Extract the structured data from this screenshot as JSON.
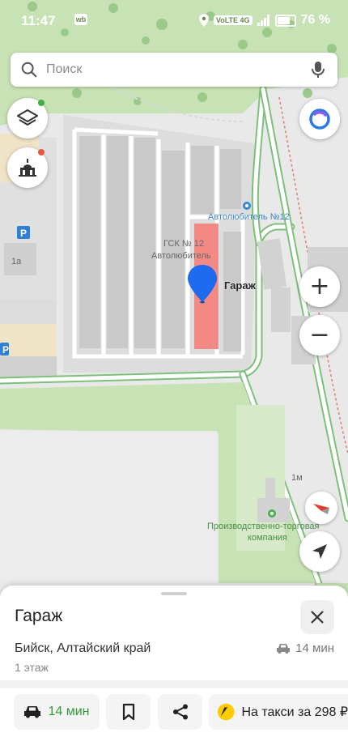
{
  "status_bar": {
    "time": "11:47",
    "app_badge": "wb",
    "network": "VoLTE 4G",
    "battery": "76 %"
  },
  "search": {
    "placeholder": "Поиск"
  },
  "map": {
    "labels": {
      "poi_autolub": "Автолюбитель №12",
      "gsk_line1": "ГСК № 12",
      "gsk_line2": "Автолюбитель",
      "selected": "Гараж",
      "house_1a": "1а",
      "house_1m": "1м",
      "company_line1": "Производственно-торговая",
      "company_line2": "компания",
      "parking": "P"
    },
    "colors": {
      "forest": "#c7e2b5",
      "garages": "#c9c9c9",
      "road": "#ffffff",
      "road_edge": "#7ec07a",
      "highlight": "#f48a86",
      "pin": "#1f6bf0",
      "poi_text": "#3a86c8"
    }
  },
  "controls": {
    "layers": "layers-icon",
    "landmarks": "landmark-icon",
    "alice": "alice-icon",
    "zoom_in": "+",
    "zoom_out": "−",
    "compass": "compass-icon",
    "locate": "location-arrow-icon"
  },
  "card": {
    "title": "Гараж",
    "address": "Бийск, Алтайский край",
    "floor": "1 этаж",
    "eta": "14 мин"
  },
  "actions": {
    "route_label": "14 мин",
    "taxi_label": "На такси за 298 ₽"
  }
}
